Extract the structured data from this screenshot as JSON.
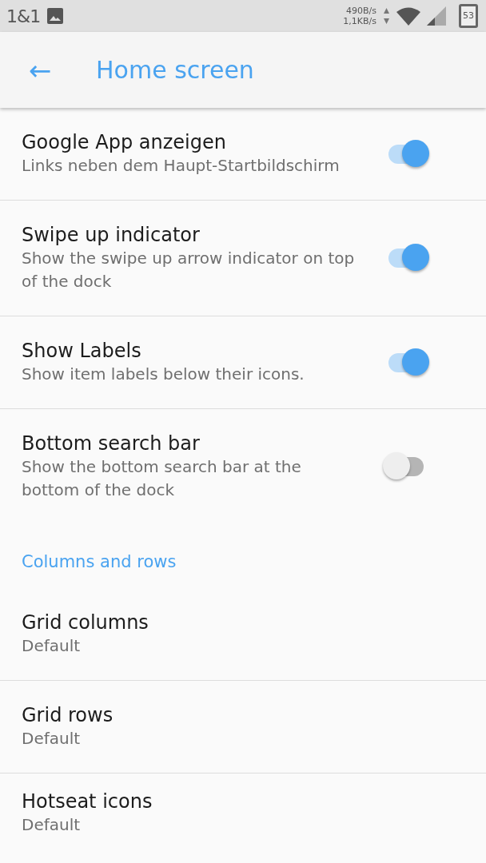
{
  "status_bar": {
    "carrier": "1&1",
    "upload_speed": "490B/s",
    "download_speed": "1,1KB/s",
    "battery": "53"
  },
  "app_bar": {
    "back": "←",
    "title": "Home screen"
  },
  "settings": [
    {
      "kind": "switch",
      "title": "Google App anzeigen",
      "summary": "Links neben dem Haupt-Startbildschirm",
      "on": true
    },
    {
      "kind": "switch",
      "title": "Swipe up indicator",
      "summary": "Show the swipe up arrow indicator on top of the dock",
      "on": true
    },
    {
      "kind": "switch",
      "title": "Show Labels",
      "summary": "Show item labels below their icons.",
      "on": true
    },
    {
      "kind": "switch",
      "title": "Bottom search bar",
      "summary": "Show the bottom search bar at the bottom of the dock",
      "on": false
    },
    {
      "kind": "header",
      "title": "Columns and rows"
    },
    {
      "kind": "plain",
      "title": "Grid columns",
      "summary": "Default"
    },
    {
      "kind": "plain",
      "title": "Grid rows",
      "summary": "Default"
    },
    {
      "kind": "plain",
      "title": "Hotseat icons",
      "summary": "Default"
    }
  ]
}
